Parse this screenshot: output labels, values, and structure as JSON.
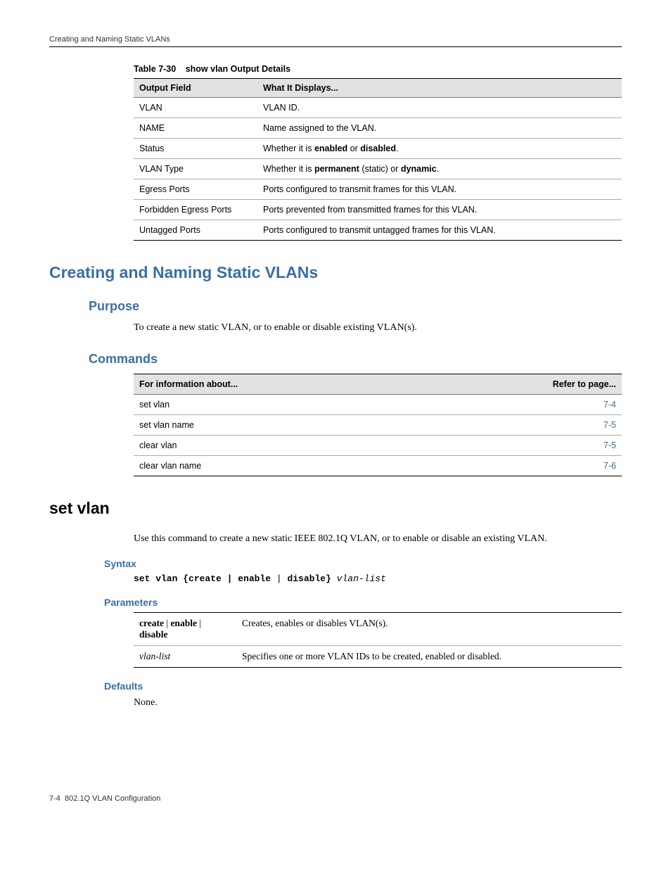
{
  "header": {
    "section": "Creating and Naming Static VLANs"
  },
  "table1": {
    "caption_num": "Table 7-30",
    "caption_title": "show vlan Output Details",
    "head_field": "Output Field",
    "head_desc": "What It Displays...",
    "rows": [
      {
        "field": "VLAN",
        "desc_pre": "VLAN ID.",
        "b1": "",
        "desc_mid": "",
        "b2": "",
        "desc_post": ""
      },
      {
        "field": "NAME",
        "desc_pre": "Name assigned to the VLAN.",
        "b1": "",
        "desc_mid": "",
        "b2": "",
        "desc_post": ""
      },
      {
        "field": "Status",
        "desc_pre": "Whether it is ",
        "b1": "enabled",
        "desc_mid": " or ",
        "b2": "disabled",
        "desc_post": "."
      },
      {
        "field": "VLAN Type",
        "desc_pre": "Whether it is ",
        "b1": "permanent",
        "desc_mid": " (static) or ",
        "b2": "dynamic",
        "desc_post": "."
      },
      {
        "field": "Egress Ports",
        "desc_pre": "Ports configured to transmit frames for this VLAN.",
        "b1": "",
        "desc_mid": "",
        "b2": "",
        "desc_post": ""
      },
      {
        "field": "Forbidden Egress Ports",
        "desc_pre": "Ports prevented from transmitted frames for this VLAN.",
        "b1": "",
        "desc_mid": "",
        "b2": "",
        "desc_post": ""
      },
      {
        "field": "Untagged Ports",
        "desc_pre": "Ports configured to transmit untagged frames for this VLAN.",
        "b1": "",
        "desc_mid": "",
        "b2": "",
        "desc_post": ""
      }
    ]
  },
  "h1_main": "Creating and Naming Static VLANs",
  "purpose": {
    "heading": "Purpose",
    "text": "To create a new static VLAN, or to enable or disable existing VLAN(s)."
  },
  "commands": {
    "heading": "Commands",
    "head_info": "For information about...",
    "head_page": "Refer to page...",
    "rows": [
      {
        "cmd": "set vlan",
        "page": "7-4"
      },
      {
        "cmd": "set vlan name",
        "page": "7-5"
      },
      {
        "cmd": "clear vlan",
        "page": "7-5"
      },
      {
        "cmd": "clear vlan name",
        "page": "7-6"
      }
    ]
  },
  "setvlan": {
    "heading": "set vlan",
    "intro": "Use this command to create a new static IEEE 802.1Q VLAN, or to enable or disable an existing VLAN.",
    "syntax_h": "Syntax",
    "syntax_kw": "set vlan {create | enable",
    "syntax_pipe": " | ",
    "syntax_kw2": "disable}",
    "syntax_ital": " vlan-list",
    "params_h": "Parameters",
    "params": [
      {
        "name_b1": "create",
        "name_sep1": " | ",
        "name_b2": "enable",
        "name_sep2": " | ",
        "name_b3": "disable",
        "desc": "Creates, enables or disables VLAN(s)."
      },
      {
        "name_i": "vlan-list",
        "desc": "Specifies one or more VLAN IDs to be created, enabled or disabled."
      }
    ],
    "defaults_h": "Defaults",
    "defaults_text": "None."
  },
  "footer": {
    "page": "7-4",
    "chapter": "802.1Q VLAN Configuration"
  }
}
